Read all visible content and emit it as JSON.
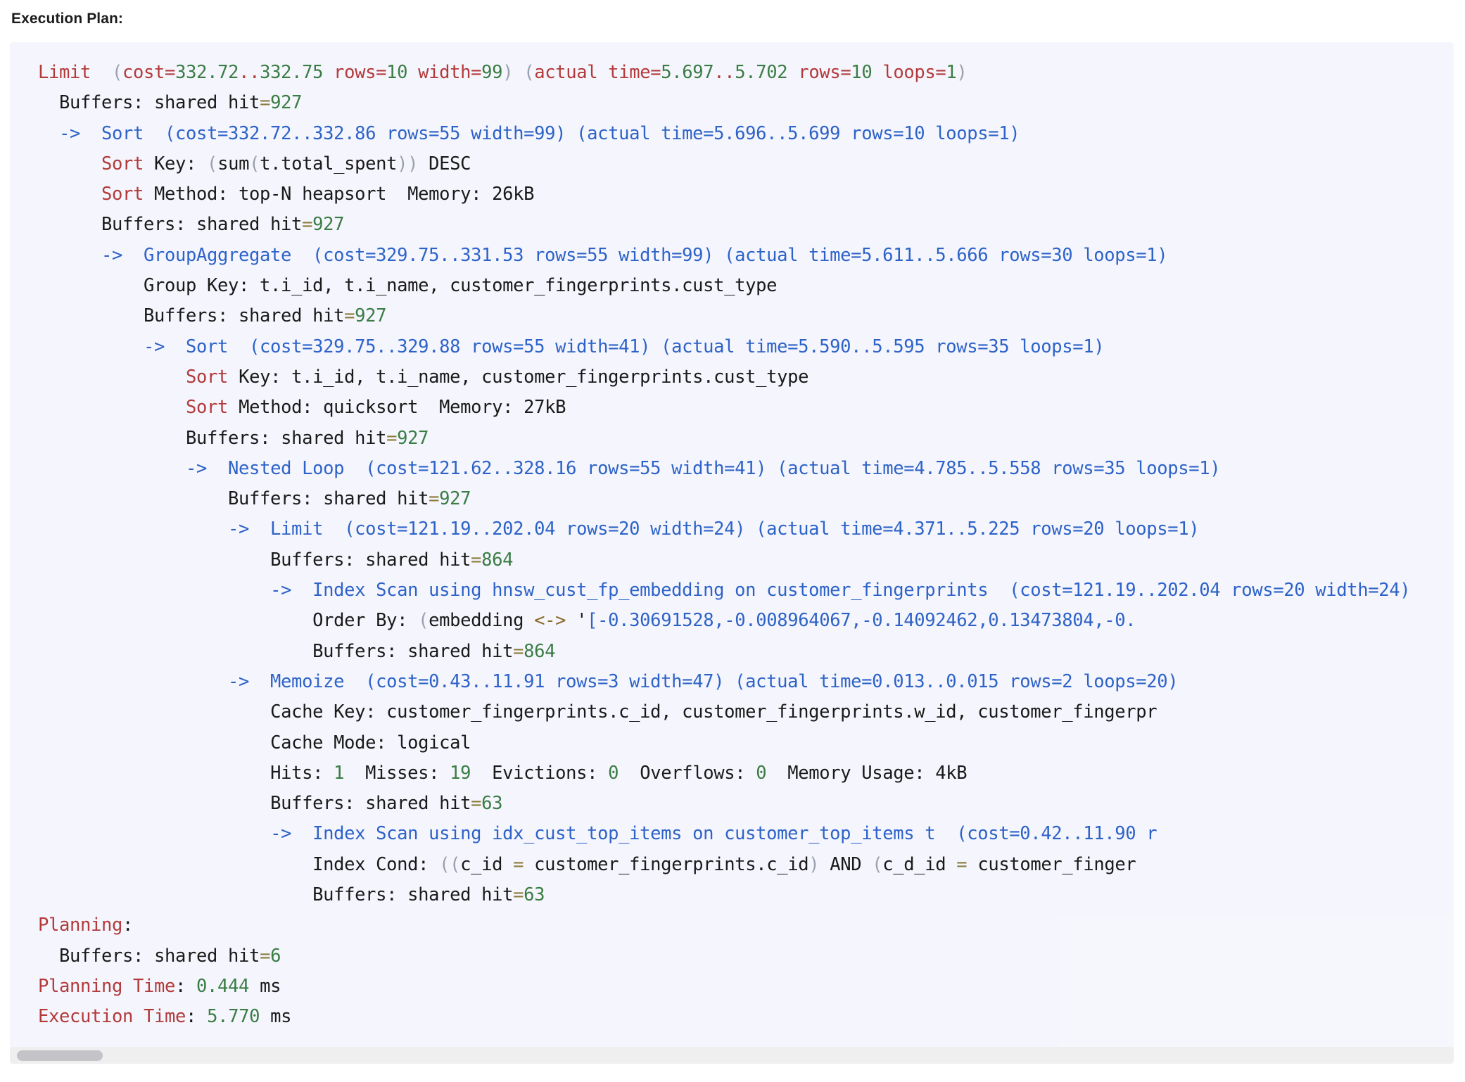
{
  "heading": "Execution Plan:",
  "scrollbar": {
    "orientation": "horizontal",
    "thumb_position": "left"
  },
  "colors": {
    "panel_background": "#f5f5fd",
    "node_top": "#b33a3a",
    "node_child": "#2d63c8",
    "number": "#3a7d44",
    "paren": "#9aa0ac",
    "equals": "#8a7b3a",
    "plain_text": "#1a1a1a",
    "operator": "#8a6d2b",
    "scrollbar_track": "#efefef",
    "scrollbar_thumb": "#c4c4c8"
  },
  "plan": {
    "summary": {
      "planning_buffers_shared_hit": "6",
      "planning_time_ms": "0.444",
      "execution_time_ms": "5.770"
    },
    "lines": [
      {
        "indent": 0,
        "tokens": [
          {
            "t": "Limit",
            "c": "n-red"
          },
          {
            "t": "  ",
            "c": "plain"
          },
          {
            "t": "(",
            "c": "paren"
          },
          {
            "t": "cost=",
            "c": "n-red"
          },
          {
            "t": "332.72",
            "c": "num"
          },
          {
            "t": "..",
            "c": "n-red"
          },
          {
            "t": "332.75",
            "c": "num"
          },
          {
            "t": " rows=",
            "c": "n-red"
          },
          {
            "t": "10",
            "c": "num"
          },
          {
            "t": " width=",
            "c": "n-red"
          },
          {
            "t": "99",
            "c": "num"
          },
          {
            "t": ")",
            "c": "paren"
          },
          {
            "t": " ",
            "c": "plain"
          },
          {
            "t": "(",
            "c": "paren"
          },
          {
            "t": "actual time=",
            "c": "n-red"
          },
          {
            "t": "5.697",
            "c": "num"
          },
          {
            "t": "..",
            "c": "n-red"
          },
          {
            "t": "5.702",
            "c": "num"
          },
          {
            "t": " rows=",
            "c": "n-red"
          },
          {
            "t": "10",
            "c": "num"
          },
          {
            "t": " loops=",
            "c": "n-red"
          },
          {
            "t": "1",
            "c": "num"
          },
          {
            "t": ")",
            "c": "paren"
          }
        ]
      },
      {
        "indent": 1,
        "tokens": [
          {
            "t": "Buffers: shared hit",
            "c": "plain"
          },
          {
            "t": "=",
            "c": "eq"
          },
          {
            "t": "927",
            "c": "num"
          }
        ]
      },
      {
        "indent": 1,
        "tokens": [
          {
            "t": "->  Sort  (cost=332.72..332.86 rows=55 width=99) (actual time=5.696..5.699 rows=10 loops=1)",
            "c": "n-blue"
          }
        ]
      },
      {
        "indent": 3,
        "tokens": [
          {
            "t": "Sort",
            "c": "n-red"
          },
          {
            "t": " Key: ",
            "c": "plain"
          },
          {
            "t": "(",
            "c": "paren"
          },
          {
            "t": "sum",
            "c": "plain"
          },
          {
            "t": "(",
            "c": "paren"
          },
          {
            "t": "t.total_spent",
            "c": "plain"
          },
          {
            "t": ")",
            "c": "paren"
          },
          {
            "t": ")",
            "c": "paren"
          },
          {
            "t": " DESC",
            "c": "plain"
          }
        ]
      },
      {
        "indent": 3,
        "tokens": [
          {
            "t": "Sort",
            "c": "n-red"
          },
          {
            "t": " Method: top-N heapsort  Memory: 26kB",
            "c": "plain"
          }
        ]
      },
      {
        "indent": 3,
        "tokens": [
          {
            "t": "Buffers: shared hit",
            "c": "plain"
          },
          {
            "t": "=",
            "c": "eq"
          },
          {
            "t": "927",
            "c": "num"
          }
        ]
      },
      {
        "indent": 3,
        "tokens": [
          {
            "t": "->  GroupAggregate  (cost=329.75..331.53 rows=55 width=99) (actual time=5.611..5.666 rows=30 loops=1)",
            "c": "n-blue"
          }
        ]
      },
      {
        "indent": 5,
        "tokens": [
          {
            "t": "Group Key: t.i_id, t.i_name, customer_fingerprints.cust_type",
            "c": "plain"
          }
        ]
      },
      {
        "indent": 5,
        "tokens": [
          {
            "t": "Buffers: shared hit",
            "c": "plain"
          },
          {
            "t": "=",
            "c": "eq"
          },
          {
            "t": "927",
            "c": "num"
          }
        ]
      },
      {
        "indent": 5,
        "tokens": [
          {
            "t": "->  Sort  (cost=329.75..329.88 rows=55 width=41) (actual time=5.590..5.595 rows=35 loops=1)",
            "c": "n-blue"
          }
        ]
      },
      {
        "indent": 7,
        "tokens": [
          {
            "t": "Sort",
            "c": "n-red"
          },
          {
            "t": " Key: t.i_id, t.i_name, customer_fingerprints.cust_type",
            "c": "plain"
          }
        ]
      },
      {
        "indent": 7,
        "tokens": [
          {
            "t": "Sort",
            "c": "n-red"
          },
          {
            "t": " Method: quicksort  Memory: 27kB",
            "c": "plain"
          }
        ]
      },
      {
        "indent": 7,
        "tokens": [
          {
            "t": "Buffers: shared hit",
            "c": "plain"
          },
          {
            "t": "=",
            "c": "eq"
          },
          {
            "t": "927",
            "c": "num"
          }
        ]
      },
      {
        "indent": 7,
        "tokens": [
          {
            "t": "->  Nested Loop  (cost=121.62..328.16 rows=55 width=41) (actual time=4.785..5.558 rows=35 loops=1)",
            "c": "n-blue"
          }
        ]
      },
      {
        "indent": 9,
        "tokens": [
          {
            "t": "Buffers: shared hit",
            "c": "plain"
          },
          {
            "t": "=",
            "c": "eq"
          },
          {
            "t": "927",
            "c": "num"
          }
        ]
      },
      {
        "indent": 9,
        "tokens": [
          {
            "t": "->  Limit  (cost=121.19..202.04 rows=20 width=24) (actual time=4.371..5.225 rows=20 loops=1)",
            "c": "n-blue"
          }
        ]
      },
      {
        "indent": 11,
        "tokens": [
          {
            "t": "Buffers: shared hit",
            "c": "plain"
          },
          {
            "t": "=",
            "c": "eq"
          },
          {
            "t": "864",
            "c": "num"
          }
        ]
      },
      {
        "indent": 11,
        "tokens": [
          {
            "t": "->  Index Scan using hnsw_cust_fp_embedding on customer_fingerprints  (cost=121.19..202.04 rows=20 width=24)",
            "c": "n-blue"
          }
        ]
      },
      {
        "indent": 13,
        "tokens": [
          {
            "t": "Order By: ",
            "c": "plain"
          },
          {
            "t": "(",
            "c": "paren"
          },
          {
            "t": "embedding ",
            "c": "plain"
          },
          {
            "t": "<->",
            "c": "op"
          },
          {
            "t": " '",
            "c": "plain"
          },
          {
            "t": "[-0.30691528,-0.008964067,-0.14092462,0.13473804,-0.",
            "c": "n-blue"
          }
        ]
      },
      {
        "indent": 13,
        "tokens": [
          {
            "t": "Buffers: shared hit",
            "c": "plain"
          },
          {
            "t": "=",
            "c": "eq"
          },
          {
            "t": "864",
            "c": "num"
          }
        ]
      },
      {
        "indent": 9,
        "tokens": [
          {
            "t": "->  Memoize  (cost=0.43..11.91 rows=3 width=47) (actual time=0.013..0.015 rows=2 loops=20)",
            "c": "n-blue"
          }
        ]
      },
      {
        "indent": 11,
        "tokens": [
          {
            "t": "Cache Key: customer_fingerprints.c_id, customer_fingerprints.w_id, customer_fingerpr",
            "c": "plain"
          }
        ]
      },
      {
        "indent": 11,
        "tokens": [
          {
            "t": "Cache Mode: logical",
            "c": "plain"
          }
        ]
      },
      {
        "indent": 11,
        "tokens": [
          {
            "t": "Hits: ",
            "c": "plain"
          },
          {
            "t": "1",
            "c": "num"
          },
          {
            "t": "  Misses: ",
            "c": "plain"
          },
          {
            "t": "19",
            "c": "num"
          },
          {
            "t": "  Evictions: ",
            "c": "plain"
          },
          {
            "t": "0",
            "c": "num"
          },
          {
            "t": "  Overflows: ",
            "c": "plain"
          },
          {
            "t": "0",
            "c": "num"
          },
          {
            "t": "  Memory Usage: 4kB",
            "c": "plain"
          }
        ]
      },
      {
        "indent": 11,
        "tokens": [
          {
            "t": "Buffers: shared hit",
            "c": "plain"
          },
          {
            "t": "=",
            "c": "eq"
          },
          {
            "t": "63",
            "c": "num"
          }
        ]
      },
      {
        "indent": 11,
        "tokens": [
          {
            "t": "->  Index Scan using idx_cust_top_items on customer_top_items t  (cost=0.42..11.90 r",
            "c": "n-blue"
          }
        ]
      },
      {
        "indent": 13,
        "tokens": [
          {
            "t": "Index Cond: ",
            "c": "plain"
          },
          {
            "t": "(",
            "c": "paren"
          },
          {
            "t": "(",
            "c": "paren"
          },
          {
            "t": "c_id ",
            "c": "plain"
          },
          {
            "t": "=",
            "c": "eq"
          },
          {
            "t": " customer_fingerprints.c_id",
            "c": "plain"
          },
          {
            "t": ")",
            "c": "paren"
          },
          {
            "t": " AND ",
            "c": "plain"
          },
          {
            "t": "(",
            "c": "paren"
          },
          {
            "t": "c_d_id ",
            "c": "plain"
          },
          {
            "t": "=",
            "c": "eq"
          },
          {
            "t": " customer_finger",
            "c": "plain"
          }
        ]
      },
      {
        "indent": 13,
        "tokens": [
          {
            "t": "Buffers: shared hit",
            "c": "plain"
          },
          {
            "t": "=",
            "c": "eq"
          },
          {
            "t": "63",
            "c": "num"
          }
        ]
      },
      {
        "indent": 0,
        "tokens": [
          {
            "t": "Planning",
            "c": "n-red"
          },
          {
            "t": ":",
            "c": "plain"
          }
        ]
      },
      {
        "indent": 1,
        "tokens": [
          {
            "t": "Buffers: shared hit",
            "c": "plain"
          },
          {
            "t": "=",
            "c": "eq"
          },
          {
            "t": "6",
            "c": "num"
          }
        ]
      },
      {
        "indent": 0,
        "tokens": [
          {
            "t": "Planning Time",
            "c": "n-red"
          },
          {
            "t": ": ",
            "c": "plain"
          },
          {
            "t": "0.444",
            "c": "num"
          },
          {
            "t": " ms",
            "c": "plain"
          }
        ]
      },
      {
        "indent": 0,
        "tokens": [
          {
            "t": "Execution Time",
            "c": "n-red"
          },
          {
            "t": ": ",
            "c": "plain"
          },
          {
            "t": "5.770",
            "c": "num"
          },
          {
            "t": " ms",
            "c": "plain"
          }
        ]
      }
    ]
  }
}
